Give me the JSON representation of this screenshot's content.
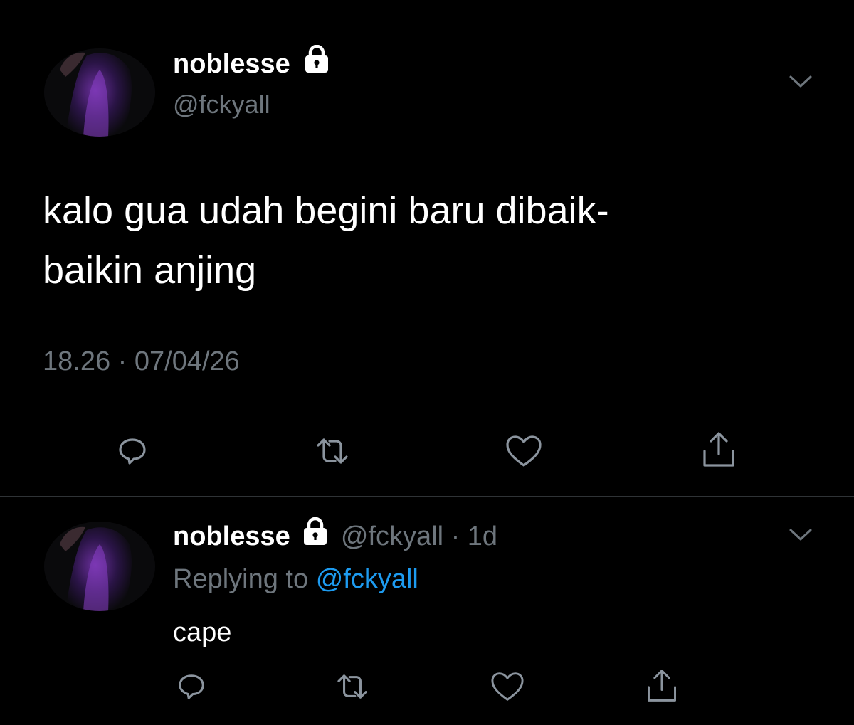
{
  "main_tweet": {
    "author": {
      "display_name": "noblesse",
      "handle": "@fckyall",
      "protected_icon": "lock-icon"
    },
    "text_line1": "kalo gua udah begini baru dibaik-",
    "text_line2": "baikin anjing",
    "timestamp": "18.26 · 07/04/26",
    "menu_icon": "chevron-down-icon",
    "actions": [
      "reply-icon",
      "retweet-icon",
      "like-icon",
      "share-icon"
    ]
  },
  "reply_tweet": {
    "author": {
      "display_name": "noblesse",
      "handle": "@fckyall",
      "protected_icon": "lock-icon"
    },
    "time_sep": "·",
    "time": "1d",
    "replying_prefix": "Replying to",
    "replying_handle": "@fckyall",
    "text": "cape",
    "menu_icon": "chevron-down-icon",
    "actions": [
      "reply-icon",
      "retweet-icon",
      "like-icon",
      "share-icon"
    ]
  },
  "colors": {
    "background": "#000000",
    "text": "#ffffff",
    "muted": "#6e767d",
    "link": "#1d9bf0",
    "divider": "#2f3336"
  }
}
